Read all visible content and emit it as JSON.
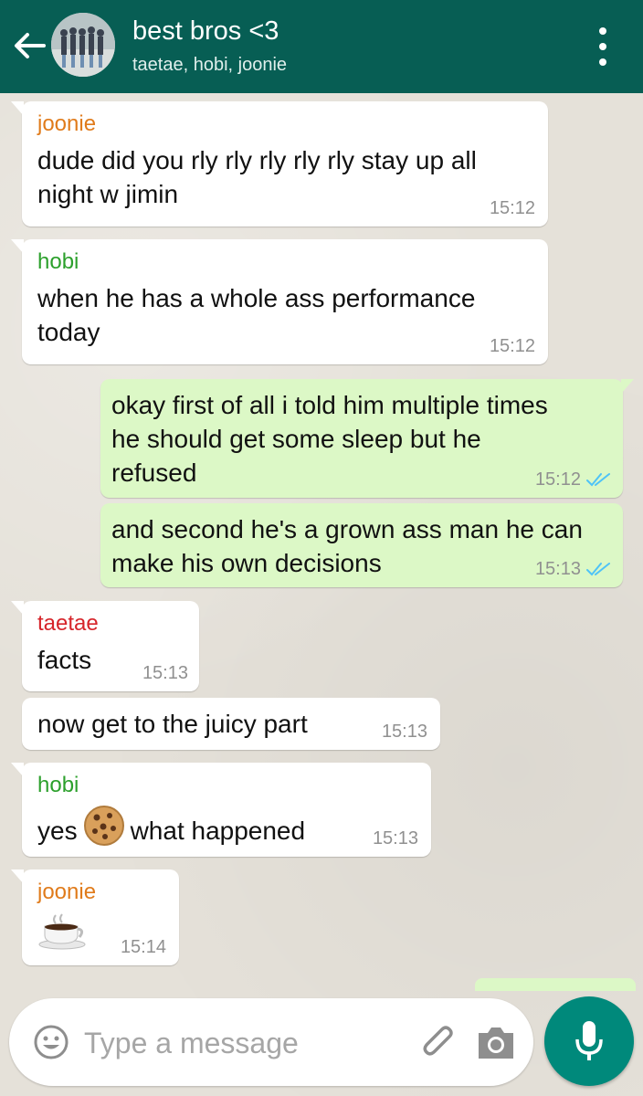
{
  "header": {
    "title": "best bros <3",
    "members": "taetae, hobi, joonie"
  },
  "colors": {
    "header_bg": "#075e54",
    "incoming_bubble": "#ffffff",
    "outgoing_bubble": "#dcf8c6",
    "sender_joonie": "#e07b1b",
    "sender_hobi": "#2ca02c",
    "sender_taetae": "#d6242a",
    "read_ticks": "#4fc3f7",
    "mic_button": "#00897b"
  },
  "messages": [
    {
      "sender": "joonie",
      "text": "dude did you rly rly rly rly rly stay up all night w jimin",
      "time": "15:12"
    },
    {
      "sender": "hobi",
      "text": "when he has a whole ass performance today",
      "time": "15:12"
    },
    {
      "text": "okay first of all i told him multiple times he should get some sleep but he refused",
      "time": "15:12",
      "status_icon": "double-check-read"
    },
    {
      "text": "and second he's a grown ass man he can make his own decisions",
      "time": "15:13",
      "status_icon": "double-check-read"
    },
    {
      "sender": "taetae",
      "text": "facts",
      "time": "15:13"
    },
    {
      "text": "now get to the juicy part",
      "time": "15:13"
    },
    {
      "sender": "hobi",
      "text_before": "yes",
      "emoji": "cookie",
      "text_after": "what happened",
      "time": "15:13"
    },
    {
      "sender": "joonie",
      "emoji": "hot-beverage",
      "time": "15:14"
    }
  ],
  "composer": {
    "placeholder": "Type a message",
    "emoji_icon": "smiley-icon",
    "attach_icon": "paperclip-icon",
    "camera_icon": "camera-icon",
    "mic_icon": "microphone-icon"
  }
}
